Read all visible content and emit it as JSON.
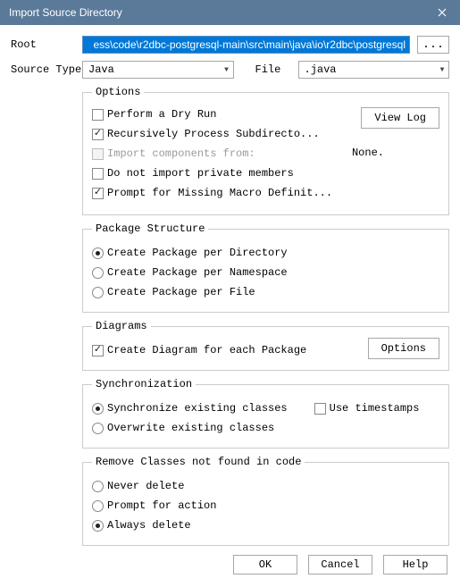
{
  "window": {
    "title": "Import Source Directory"
  },
  "labels": {
    "root": "Root",
    "source_type": "Source Type",
    "file": "File"
  },
  "root": {
    "value": "ess\\code\\r2dbc-postgresql-main\\src\\main\\java\\io\\r2dbc\\postgresql",
    "browse": "..."
  },
  "source_type": {
    "value": "Java"
  },
  "file": {
    "value": ".java"
  },
  "options": {
    "legend": "Options",
    "dry_run": "Perform a Dry Run",
    "recurse": "Recursively Process Subdirecto...",
    "import_from": "Import components from:",
    "import_from_value": "None.",
    "no_private": "Do not import private members",
    "prompt_macro": "Prompt for Missing Macro Definit...",
    "view_log": "View Log"
  },
  "pkg": {
    "legend": "Package Structure",
    "per_dir": "Create Package per Directory",
    "per_ns": "Create Package per Namespace",
    "per_file": "Create Package per File"
  },
  "diagrams": {
    "legend": "Diagrams",
    "create": "Create Diagram for each Package",
    "options_btn": "Options"
  },
  "sync": {
    "legend": "Synchronization",
    "sync_existing": "Synchronize existing classes",
    "overwrite": "Overwrite existing classes",
    "use_ts": "Use timestamps"
  },
  "remove": {
    "legend": "Remove Classes not found in code",
    "never": "Never delete",
    "prompt": "Prompt for action",
    "always": "Always delete"
  },
  "buttons": {
    "ok": "OK",
    "cancel": "Cancel",
    "help": "Help"
  }
}
